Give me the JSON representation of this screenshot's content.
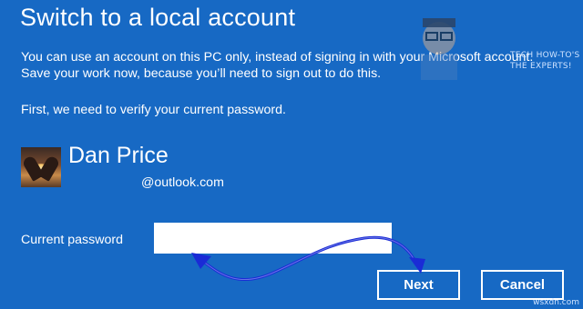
{
  "dialog": {
    "title": "Switch to a local account",
    "description_line1": "You can use an account on this PC only, instead of signing in with your Microsoft account.",
    "description_line2": "Save your work now, because you’ll need to sign out to do this.",
    "verify_text": "First, we need to verify your current password."
  },
  "user": {
    "name": "Dan Price",
    "email": "@outlook.com"
  },
  "password": {
    "label": "Current password",
    "value": "",
    "placeholder": ""
  },
  "buttons": {
    "next_label": "Next",
    "cancel_label": "Cancel"
  },
  "watermark": {
    "line1": "TECH HOW-TO'S FROM",
    "line2": "THE EXPERTS!",
    "corner": "wsxdn.com"
  },
  "colors": {
    "background": "#1769c4",
    "text": "#ffffff",
    "annotation_arrow": "#1a2bd6"
  },
  "icons": {
    "avatar": "user-avatar-photo",
    "annotation": "double-headed-arrow"
  }
}
